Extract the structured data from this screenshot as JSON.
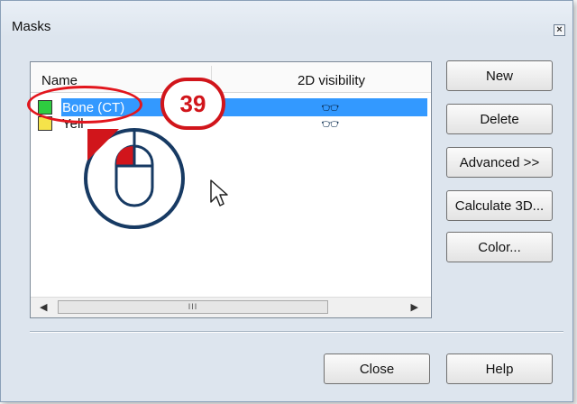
{
  "dialog": {
    "title": "Masks"
  },
  "list": {
    "columns": [
      "Name",
      "2D visibility"
    ],
    "rows": [
      {
        "name": "Bone (CT)",
        "color": "#2ecc40",
        "selected": true,
        "visibility_icon": "glasses-icon"
      },
      {
        "name": "Yell",
        "color": "#f5e34a",
        "selected": false,
        "visibility_icon": "glasses-icon"
      }
    ],
    "scrollbar_grip": "III"
  },
  "buttons": {
    "new": "New",
    "delete": "Delete",
    "advanced": "Advanced >>",
    "calculate3d": "Calculate 3D...",
    "color": "Color...",
    "close": "Close",
    "help": "Help"
  },
  "annotation": {
    "step_number": "39",
    "accent": "#d1151b"
  }
}
